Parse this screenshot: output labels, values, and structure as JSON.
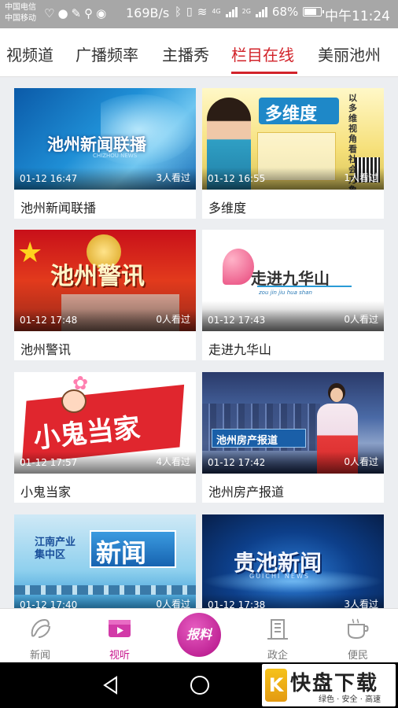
{
  "status": {
    "carrier1": "中国电信",
    "carrier2": "中国移动",
    "speed": "169B/s",
    "net_4g": "4G",
    "net_2g": "2G",
    "battery": "68%",
    "time": "中午11:24"
  },
  "tabs": [
    {
      "label": "视频道",
      "active": false
    },
    {
      "label": "广播频率",
      "active": false
    },
    {
      "label": "主播秀",
      "active": false
    },
    {
      "label": "栏目在线",
      "active": true
    },
    {
      "label": "美丽池州",
      "active": false
    }
  ],
  "videos": [
    {
      "title": "池州新闻联播",
      "date": "01-12 16:47",
      "views": "3人看过",
      "art": "池州新闻联播",
      "art_sub": "CHIZHOU NEWS"
    },
    {
      "title": "多维度",
      "date": "01-12 16:55",
      "views": "1人看过",
      "art": "多维度",
      "art_side": "以多维视角看社会万象"
    },
    {
      "title": "池州警讯",
      "date": "01-12 17:48",
      "views": "0人看过",
      "art": "池州警讯"
    },
    {
      "title": "走进九华山",
      "date": "01-12 17:43",
      "views": "0人看过",
      "art": "走进九华山",
      "art_sub": "zou jin jiu hua shan"
    },
    {
      "title": "小鬼当家",
      "date": "01-12 17:57",
      "views": "4人看过",
      "art": "小鬼当家"
    },
    {
      "title": "池州房产报道",
      "date": "01-12 17:42",
      "views": "0人看过",
      "art": "池州房产报道"
    },
    {
      "title": "",
      "date": "01-12 17:40",
      "views": "0人看过",
      "art": "新闻",
      "art_side": "江南产业集中区"
    },
    {
      "title": "",
      "date": "01-12 17:38",
      "views": "3人看过",
      "art": "贵池新闻",
      "art_sub": "GUICHI NEWS"
    }
  ],
  "bottom_nav": [
    {
      "label": "新闻",
      "icon": "news-icon",
      "active": false
    },
    {
      "label": "视听",
      "icon": "video-icon",
      "active": true
    },
    {
      "label": "报料",
      "icon": "report-button",
      "active": false
    },
    {
      "label": "政企",
      "icon": "building-icon",
      "active": false
    },
    {
      "label": "便民",
      "icon": "cup-icon",
      "active": false
    }
  ],
  "watermark": {
    "logo_text": "K",
    "brand": "快盘下载",
    "slogan": "绿色 · 安全 · 高速"
  },
  "colors": {
    "accent": "#d2232a",
    "nav_active": "#c8178e"
  }
}
